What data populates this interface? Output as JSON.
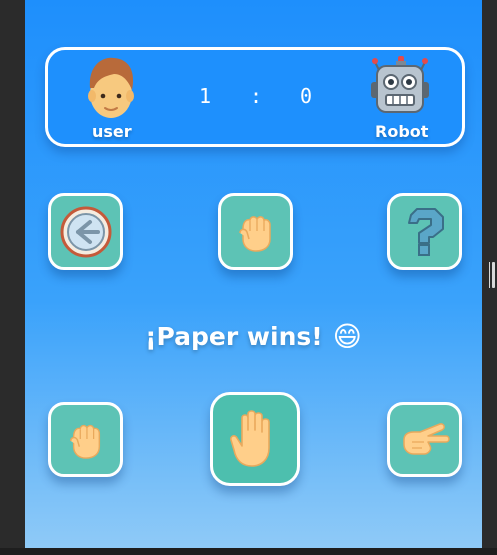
{
  "scoreboard": {
    "user_label": "user",
    "robot_label": "Robot",
    "user_score": "1",
    "separator": ":",
    "robot_score": "0"
  },
  "controls": {
    "back_icon": "back-arrow-icon",
    "last_robot_choice_icon": "rock-fist-icon",
    "help_icon": "question-mark-icon"
  },
  "result": {
    "message": "¡Paper wins!",
    "emoji": "😄"
  },
  "choices": [
    {
      "name": "rock",
      "icon": "rock-fist-icon"
    },
    {
      "name": "paper",
      "icon": "paper-hand-icon",
      "selected": true
    },
    {
      "name": "scissors",
      "icon": "scissors-hand-icon"
    }
  ],
  "colors": {
    "background_top": "#1e8ffc",
    "background_bottom": "#8fcaf7",
    "tile": "#5dc3b5",
    "border": "#ffffff"
  }
}
